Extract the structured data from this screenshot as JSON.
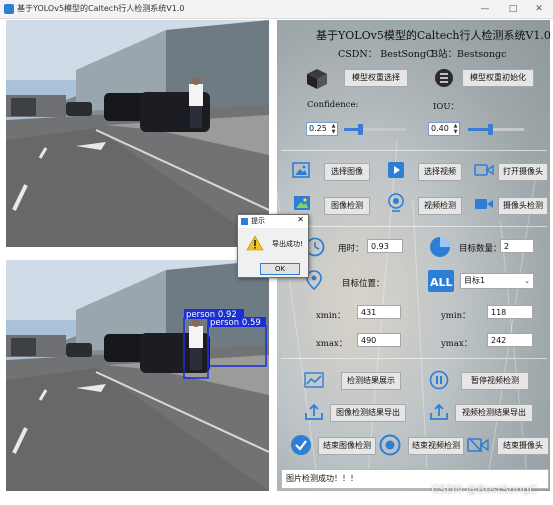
{
  "window": {
    "title": "基于YOLOv5模型的Caltech行人检测系统V1.0"
  },
  "header": {
    "title": "基于YOLOv5模型的Caltech行人检测系统V1.0",
    "csdn": "CSDN：  BestSongC",
    "bilibili": "B站：Bestsongc"
  },
  "model": {
    "select_label": "模型权重选择",
    "init_label": "模型权重初始化"
  },
  "params": {
    "confidence_label": "Confidence:",
    "confidence_value": "0.25",
    "confidence_level": 0.25,
    "iou_label": "IOU：",
    "iou_value": "0.40",
    "iou_level": 0.4
  },
  "actions": {
    "select_image": "选择图像",
    "select_video": "选择视频",
    "open_camera": "打开摄像头",
    "image_detect": "图像检测",
    "video_detect": "视频检测",
    "camera_detect": "摄像头检测"
  },
  "results": {
    "time_label": "用时：",
    "time_value": "0.93",
    "count_label": "目标数量：",
    "count_value": "2",
    "position_label": "目标位置：",
    "target_select": "目标1",
    "xmin_label": "xmin：",
    "xmin_value": "431",
    "ymin_label": "ymin：",
    "ymin_value": "118",
    "xmax_label": "xmax：",
    "xmax_value": "490",
    "ymax_label": "ymax：",
    "ymax_value": "242"
  },
  "bottom_actions": {
    "show_results": "检测结果展示",
    "pause_video": "暂停视频检测",
    "export_image": "图像检测结果导出",
    "export_video": "视频检测结果导出",
    "end_image": "结束图像检测",
    "end_video": "结束视频检测",
    "end_camera": "结束摄像头"
  },
  "detections": [
    {
      "label": "person 0.92"
    },
    {
      "label": "person 0.59"
    }
  ],
  "dialog": {
    "title": "提示",
    "message": "导出成功!",
    "ok": "OK"
  },
  "status": {
    "text": "图片检测成功！！！"
  },
  "watermark": "CSDN @BestSongC",
  "colors": {
    "accent_blue": "#2d7fd6",
    "bbox_blue": "#1a2fd6",
    "slider_blue": "#3a7bd5"
  }
}
